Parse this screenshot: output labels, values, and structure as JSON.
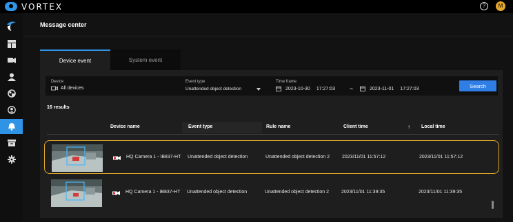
{
  "app": {
    "brand": "VORTEX",
    "help_icon": "?",
    "avatar_initial": "M"
  },
  "page": {
    "title": "Message center"
  },
  "tabs": [
    {
      "label": "Device event",
      "active": true
    },
    {
      "label": "System event",
      "active": false
    }
  ],
  "filters": {
    "device_label": "Device",
    "device_value": "All devices",
    "event_type_label": "Event type",
    "event_type_value": "Unattended object detection",
    "time_frame_label": "Time frame",
    "start_date": "2023-10-30",
    "start_time": "17:27:03",
    "range_separator": "~",
    "end_date": "2023-11-01",
    "end_time": "17:27:03",
    "search_label": "Search"
  },
  "results": {
    "count_text": "16 results"
  },
  "table": {
    "headers": {
      "device_name": "Device name",
      "event_type": "Event type",
      "rule_name": "Rule name",
      "client_time": "Client time",
      "sort_indicator": "↑",
      "local_time": "Local time"
    },
    "rows": [
      {
        "device_name": "HQ Camera 1 - IB837-HT",
        "event_type": "Unattended object detection",
        "rule_name": "Unattended object detection 2",
        "client_time": "2023/11/01 11:57:12",
        "local_time": "2023/11/01 11:57:12",
        "selected": true
      },
      {
        "device_name": "HQ Camera 1 - IB837-HT",
        "event_type": "Unattended object detection",
        "rule_name": "Unattended object detection 2",
        "client_time": "2023/11/01 11:39:35",
        "local_time": "2023/11/01 11:39:35",
        "selected": false
      }
    ]
  },
  "colors": {
    "accent": "#2f93e6",
    "selection": "#e3a92c",
    "avatar": "#e8a72c"
  },
  "sidebar_icons": [
    "dashboard-icon",
    "camera-icon",
    "user-icon",
    "rules-icon",
    "account-icon",
    "bell-icon",
    "archive-icon",
    "gear-icon"
  ]
}
